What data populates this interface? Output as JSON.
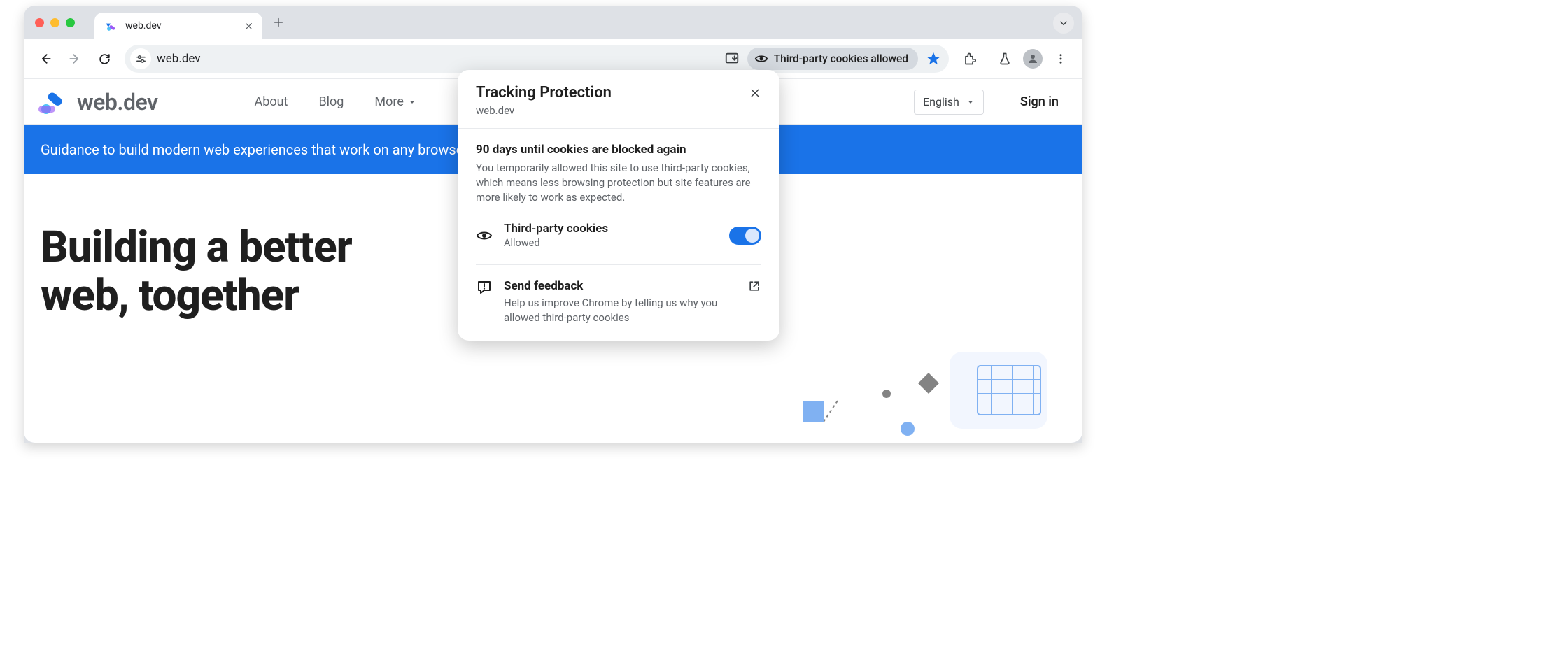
{
  "browser": {
    "tab_title": "web.dev",
    "url": "web.dev",
    "cookies_chip": "Third-party cookies allowed"
  },
  "site": {
    "brand": "web.dev",
    "nav": {
      "about": "About",
      "blog": "Blog",
      "more": "More"
    },
    "language": "English",
    "sign_in": "Sign in",
    "banner": "Guidance to build modern web experiences that work on any browser.",
    "hero_line1": "Building a better",
    "hero_line2": "web, together"
  },
  "popover": {
    "title": "Tracking Protection",
    "host": "web.dev",
    "countdown_title": "90 days until cookies are blocked again",
    "countdown_text": "You temporarily allowed this site to use third-party cookies, which means less browsing protection but site features are more likely to work as expected.",
    "tp_row_title": "Third-party cookies",
    "tp_row_status": "Allowed",
    "feedback_title": "Send feedback",
    "feedback_text": "Help us improve Chrome by telling us why you allowed third-party cookies"
  }
}
